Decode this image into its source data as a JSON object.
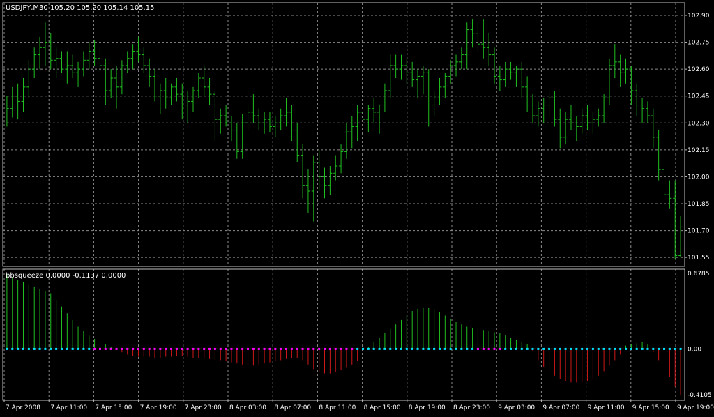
{
  "colors": {
    "background": "#000000",
    "grid": "#8c8c8c",
    "frame": "#c0c0c0",
    "text": "#ffffff",
    "bar": "#20c020",
    "hist_up": "#20c020",
    "hist_down": "#d01818",
    "squeeze_on": "#ff00ff",
    "squeeze_off": "#00e0ff"
  },
  "chart_data": [
    {
      "type": "ohlc-bar",
      "title": "USDJPY,M30  105.20 105.20 105.14 105.15",
      "ylim": [
        101.5,
        102.97
      ],
      "y_tick_labels": [
        "102.90",
        "102.75",
        "102.60",
        "102.45",
        "102.30",
        "102.15",
        "102.00",
        "101.85",
        "101.70",
        "101.55"
      ],
      "y_ticks": [
        102.9,
        102.75,
        102.6,
        102.45,
        102.3,
        102.15,
        102.0,
        101.85,
        101.7,
        101.55
      ],
      "grid": true,
      "ohlc": [
        [
          102.4,
          102.45,
          102.28,
          102.38
        ],
        [
          102.38,
          102.5,
          102.33,
          102.45
        ],
        [
          102.45,
          102.52,
          102.32,
          102.42
        ],
        [
          102.42,
          102.55,
          102.36,
          102.5
        ],
        [
          102.5,
          102.65,
          102.44,
          102.6
        ],
        [
          102.6,
          102.72,
          102.55,
          102.68
        ],
        [
          102.68,
          102.78,
          102.6,
          102.72
        ],
        [
          102.72,
          102.86,
          102.62,
          102.75
        ],
        [
          102.75,
          102.8,
          102.6,
          102.65
        ],
        [
          102.65,
          102.72,
          102.55,
          102.66
        ],
        [
          102.66,
          102.7,
          102.58,
          102.6
        ],
        [
          102.6,
          102.7,
          102.52,
          102.62
        ],
        [
          102.62,
          102.68,
          102.55,
          102.58
        ],
        [
          102.58,
          102.64,
          102.5,
          102.6
        ],
        [
          102.6,
          102.7,
          102.56,
          102.65
        ],
        [
          102.65,
          102.75,
          102.6,
          102.7
        ],
        [
          102.7,
          102.76,
          102.62,
          102.66
        ],
        [
          102.66,
          102.72,
          102.58,
          102.62
        ],
        [
          102.62,
          102.66,
          102.4,
          102.48
        ],
        [
          102.48,
          102.6,
          102.44,
          102.55
        ],
        [
          102.55,
          102.62,
          102.38,
          102.5
        ],
        [
          102.5,
          102.65,
          102.46,
          102.62
        ],
        [
          102.62,
          102.7,
          102.58,
          102.66
        ],
        [
          102.66,
          102.74,
          102.6,
          102.7
        ],
        [
          102.7,
          102.78,
          102.64,
          102.68
        ],
        [
          102.68,
          102.72,
          102.58,
          102.62
        ],
        [
          102.62,
          102.66,
          102.5,
          102.56
        ],
        [
          102.56,
          102.6,
          102.42,
          102.45
        ],
        [
          102.45,
          102.52,
          102.35,
          102.48
        ],
        [
          102.48,
          102.55,
          102.38,
          102.44
        ],
        [
          102.44,
          102.52,
          102.4,
          102.5
        ],
        [
          102.5,
          102.55,
          102.42,
          102.46
        ],
        [
          102.46,
          102.52,
          102.32,
          102.4
        ],
        [
          102.4,
          102.48,
          102.3,
          102.42
        ],
        [
          102.42,
          102.5,
          102.36,
          102.48
        ],
        [
          102.48,
          102.58,
          102.44,
          102.55
        ],
        [
          102.55,
          102.62,
          102.45,
          102.5
        ],
        [
          102.5,
          102.55,
          102.4,
          102.46
        ],
        [
          102.46,
          102.48,
          102.2,
          102.32
        ],
        [
          102.32,
          102.38,
          102.24,
          102.34
        ],
        [
          102.34,
          102.4,
          102.28,
          102.3
        ],
        [
          102.3,
          102.34,
          102.2,
          102.26
        ],
        [
          102.26,
          102.3,
          102.1,
          102.14
        ],
        [
          102.14,
          102.35,
          102.1,
          102.3
        ],
        [
          102.3,
          102.4,
          102.26,
          102.36
        ],
        [
          102.36,
          102.46,
          102.3,
          102.34
        ],
        [
          102.34,
          102.38,
          102.26,
          102.3
        ],
        [
          102.3,
          102.36,
          102.24,
          102.32
        ],
        [
          102.32,
          102.36,
          102.25,
          102.28
        ],
        [
          102.28,
          102.34,
          102.22,
          102.3
        ],
        [
          102.3,
          102.38,
          102.26,
          102.34
        ],
        [
          102.34,
          102.44,
          102.28,
          102.36
        ],
        [
          102.36,
          102.4,
          102.2,
          102.26
        ],
        [
          102.26,
          102.3,
          102.08,
          102.12
        ],
        [
          102.12,
          102.18,
          101.88,
          101.95
        ],
        [
          101.95,
          102.04,
          101.8,
          101.92
        ],
        [
          101.92,
          102.12,
          101.75,
          102.08
        ],
        [
          102.08,
          102.15,
          101.92,
          102.0
        ],
        [
          102.0,
          102.05,
          101.88,
          101.95
        ],
        [
          101.95,
          102.06,
          101.9,
          102.02
        ],
        [
          102.02,
          102.12,
          101.98,
          102.06
        ],
        [
          102.06,
          102.18,
          102.02,
          102.14
        ],
        [
          102.14,
          102.3,
          102.1,
          102.25
        ],
        [
          102.25,
          102.34,
          102.16,
          102.28
        ],
        [
          102.28,
          102.4,
          102.2,
          102.36
        ],
        [
          102.36,
          102.42,
          102.26,
          102.32
        ],
        [
          102.32,
          102.4,
          102.25,
          102.38
        ],
        [
          102.38,
          102.44,
          102.3,
          102.36
        ],
        [
          102.36,
          102.4,
          102.24,
          102.4
        ],
        [
          102.4,
          102.52,
          102.36,
          102.48
        ],
        [
          102.48,
          102.68,
          102.44,
          102.62
        ],
        [
          102.62,
          102.68,
          102.55,
          102.6
        ],
        [
          102.6,
          102.68,
          102.54,
          102.62
        ],
        [
          102.62,
          102.66,
          102.52,
          102.58
        ],
        [
          102.58,
          102.64,
          102.5,
          102.54
        ],
        [
          102.54,
          102.6,
          102.44,
          102.56
        ],
        [
          102.56,
          102.62,
          102.46,
          102.58
        ],
        [
          102.58,
          102.6,
          102.28,
          102.4
        ],
        [
          102.4,
          102.48,
          102.34,
          102.44
        ],
        [
          102.44,
          102.55,
          102.4,
          102.5
        ],
        [
          102.5,
          102.58,
          102.44,
          102.56
        ],
        [
          102.56,
          102.65,
          102.52,
          102.62
        ],
        [
          102.62,
          102.68,
          102.56,
          102.64
        ],
        [
          102.64,
          102.72,
          102.6,
          102.68
        ],
        [
          102.68,
          102.86,
          102.6,
          102.82
        ],
        [
          102.82,
          102.88,
          102.72,
          102.8
        ],
        [
          102.8,
          102.86,
          102.7,
          102.74
        ],
        [
          102.74,
          102.88,
          102.66,
          102.72
        ],
        [
          102.72,
          102.8,
          102.62,
          102.68
        ],
        [
          102.68,
          102.72,
          102.52,
          102.56
        ],
        [
          102.56,
          102.62,
          102.48,
          102.54
        ],
        [
          102.54,
          102.64,
          102.5,
          102.6
        ],
        [
          102.6,
          102.64,
          102.54,
          102.58
        ],
        [
          102.58,
          102.62,
          102.5,
          102.6
        ],
        [
          102.6,
          102.64,
          102.44,
          102.5
        ],
        [
          102.5,
          102.56,
          102.36,
          102.4
        ],
        [
          102.4,
          102.46,
          102.3,
          102.34
        ],
        [
          102.34,
          102.42,
          102.28,
          102.38
        ],
        [
          102.38,
          102.44,
          102.3,
          102.4
        ],
        [
          102.4,
          102.48,
          102.34,
          102.44
        ],
        [
          102.44,
          102.48,
          102.28,
          102.32
        ],
        [
          102.32,
          102.38,
          102.16,
          102.22
        ],
        [
          102.22,
          102.36,
          102.18,
          102.32
        ],
        [
          102.32,
          102.4,
          102.26,
          102.3
        ],
        [
          102.3,
          102.34,
          102.2,
          102.28
        ],
        [
          102.28,
          102.38,
          102.24,
          102.34
        ],
        [
          102.34,
          102.4,
          102.26,
          102.3
        ],
        [
          102.3,
          102.36,
          102.24,
          102.32
        ],
        [
          102.32,
          102.38,
          102.28,
          102.34
        ],
        [
          102.34,
          102.46,
          102.3,
          102.44
        ],
        [
          102.44,
          102.66,
          102.4,
          102.62
        ],
        [
          102.62,
          102.74,
          102.55,
          102.64
        ],
        [
          102.64,
          102.68,
          102.5,
          102.58
        ],
        [
          102.58,
          102.66,
          102.52,
          102.6
        ],
        [
          102.6,
          102.62,
          102.4,
          102.48
        ],
        [
          102.48,
          102.52,
          102.34,
          102.4
        ],
        [
          102.4,
          102.44,
          102.3,
          102.38
        ],
        [
          102.38,
          102.42,
          102.3,
          102.34
        ],
        [
          102.34,
          102.38,
          102.16,
          102.22
        ],
        [
          102.22,
          102.26,
          101.98,
          102.04
        ],
        [
          102.04,
          102.08,
          101.84,
          101.9
        ],
        [
          101.9,
          101.98,
          101.82,
          101.88
        ],
        [
          101.88,
          101.98,
          101.54,
          101.56
        ],
        [
          101.56,
          101.78,
          101.55,
          101.72
        ]
      ],
      "x_tick_labels": [
        "7 Apr 2008",
        "7 Apr 11:00",
        "7 Apr 15:00",
        "7 Apr 19:00",
        "7 Apr 23:00",
        "8 Apr 03:00",
        "8 Apr 07:00",
        "8 Apr 11:00",
        "8 Apr 15:00",
        "8 Apr 19:00",
        "8 Apr 23:00",
        "9 Apr 03:00",
        "9 Apr 07:00",
        "9 Apr 11:00",
        "9 Apr 15:00",
        "9 Apr 19:00"
      ]
    },
    {
      "type": "bar",
      "title": "bbsqueeze 0.0000 -0.1137 0.0000",
      "ylim": [
        -0.4105,
        0.6785
      ],
      "y_tick_labels": [
        "0.6785",
        "0.00",
        "-0.4105"
      ],
      "y_ticks": [
        0.6785,
        0.0,
        -0.4105
      ],
      "values": [
        0.66,
        0.64,
        0.62,
        0.6,
        0.58,
        0.56,
        0.54,
        0.52,
        0.5,
        0.44,
        0.38,
        0.32,
        0.26,
        0.2,
        0.16,
        0.12,
        0.09,
        0.06,
        0.04,
        0.02,
        -0.01,
        -0.03,
        -0.05,
        -0.06,
        -0.07,
        -0.07,
        -0.07,
        -0.08,
        -0.08,
        -0.07,
        -0.07,
        -0.06,
        -0.06,
        -0.07,
        -0.08,
        -0.08,
        -0.08,
        -0.09,
        -0.1,
        -0.1,
        -0.11,
        -0.12,
        -0.13,
        -0.14,
        -0.15,
        -0.15,
        -0.14,
        -0.13,
        -0.12,
        -0.11,
        -0.1,
        -0.09,
        -0.08,
        -0.08,
        -0.1,
        -0.14,
        -0.18,
        -0.21,
        -0.22,
        -0.22,
        -0.21,
        -0.19,
        -0.17,
        -0.14,
        -0.11,
        -0.08,
        0.02,
        0.06,
        0.1,
        0.14,
        0.18,
        0.22,
        0.26,
        0.3,
        0.34,
        0.36,
        0.37,
        0.37,
        0.36,
        0.33,
        0.3,
        0.27,
        0.24,
        0.22,
        0.2,
        0.19,
        0.18,
        0.17,
        0.16,
        0.15,
        0.14,
        0.12,
        0.1,
        0.08,
        0.06,
        0.04,
        -0.02,
        -0.1,
        -0.16,
        -0.2,
        -0.24,
        -0.27,
        -0.29,
        -0.3,
        -0.3,
        -0.3,
        -0.29,
        -0.27,
        -0.24,
        -0.2,
        -0.15,
        -0.1,
        -0.05,
        0.03,
        0.04,
        0.05,
        0.06,
        0.04,
        -0.03,
        -0.1,
        -0.18,
        -0.25,
        -0.34,
        -0.41
      ],
      "dots": [
        1,
        1,
        1,
        1,
        1,
        1,
        1,
        1,
        1,
        1,
        1,
        1,
        1,
        1,
        1,
        1,
        0,
        0,
        0,
        0,
        0,
        0,
        0,
        0,
        0,
        0,
        0,
        0,
        0,
        0,
        0,
        0,
        0,
        0,
        0,
        0,
        0,
        0,
        0,
        0,
        0,
        0,
        0,
        0,
        0,
        0,
        0,
        0,
        0,
        0,
        0,
        0,
        0,
        0,
        0,
        0,
        0,
        0,
        0,
        0,
        0,
        0,
        0,
        0,
        1,
        1,
        1,
        1,
        1,
        1,
        1,
        1,
        1,
        1,
        1,
        1,
        1,
        1,
        1,
        1,
        1,
        1,
        1,
        1,
        1,
        1,
        0,
        0,
        0,
        0,
        0,
        1,
        1,
        1,
        1,
        1,
        1,
        1,
        1,
        1,
        1,
        1,
        1,
        1,
        1,
        1,
        1,
        1,
        1,
        1,
        1,
        1,
        1,
        1,
        1,
        1,
        1,
        1,
        1,
        1,
        1,
        1,
        1,
        1
      ]
    }
  ]
}
